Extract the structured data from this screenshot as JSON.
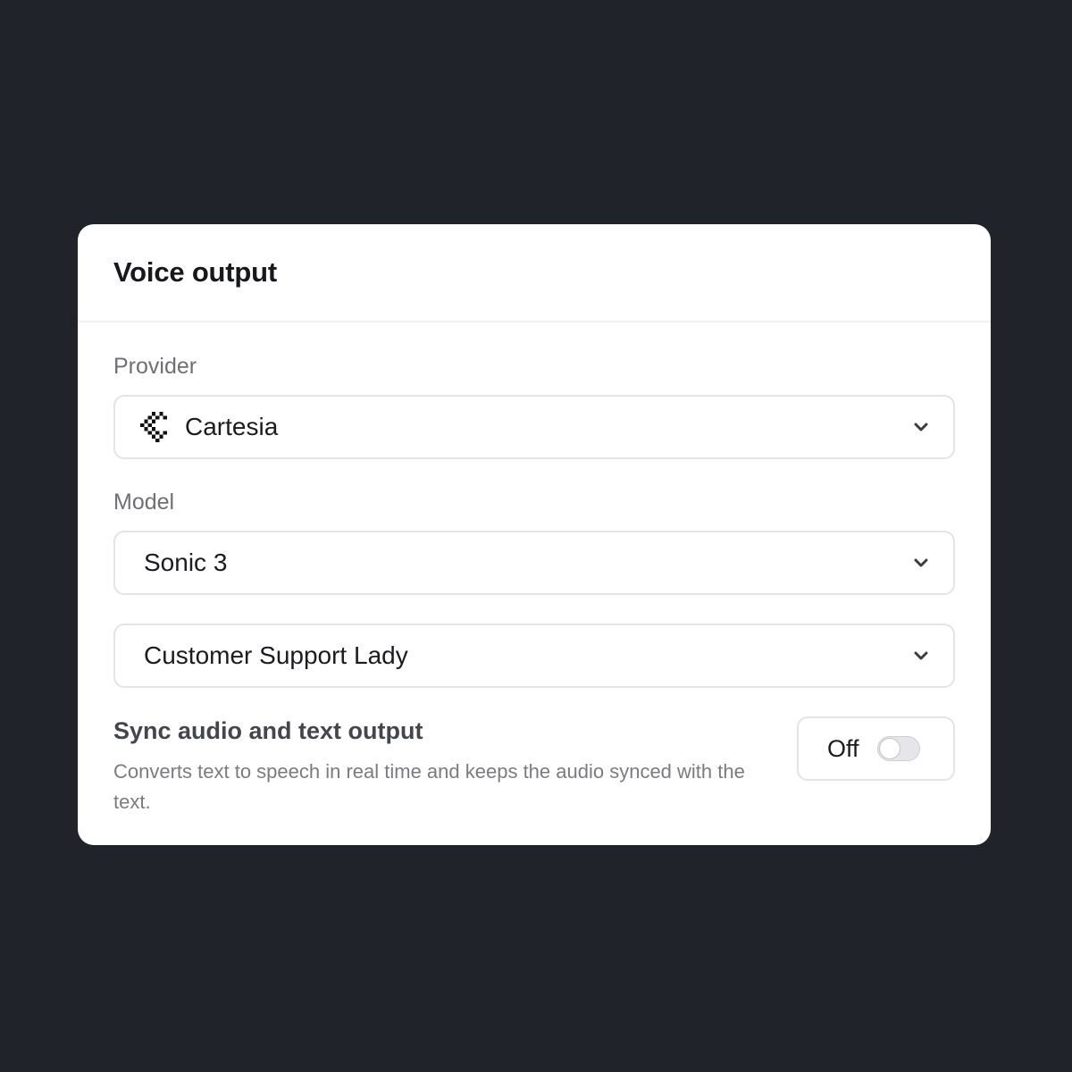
{
  "panel": {
    "title": "Voice output"
  },
  "provider": {
    "label": "Provider",
    "value": "Cartesia",
    "icon": "cartesia-logo-icon"
  },
  "model": {
    "label": "Model",
    "value": "Sonic 3"
  },
  "voice": {
    "value": "Customer Support Lady"
  },
  "sync": {
    "title": "Sync audio and text output",
    "description": "Converts text to speech in real time and keeps the audio synced with the text.",
    "toggle_label": "Off",
    "enabled": false
  },
  "colors": {
    "background": "#21232b",
    "card": "#ffffff",
    "border": "#e4e4e8"
  }
}
